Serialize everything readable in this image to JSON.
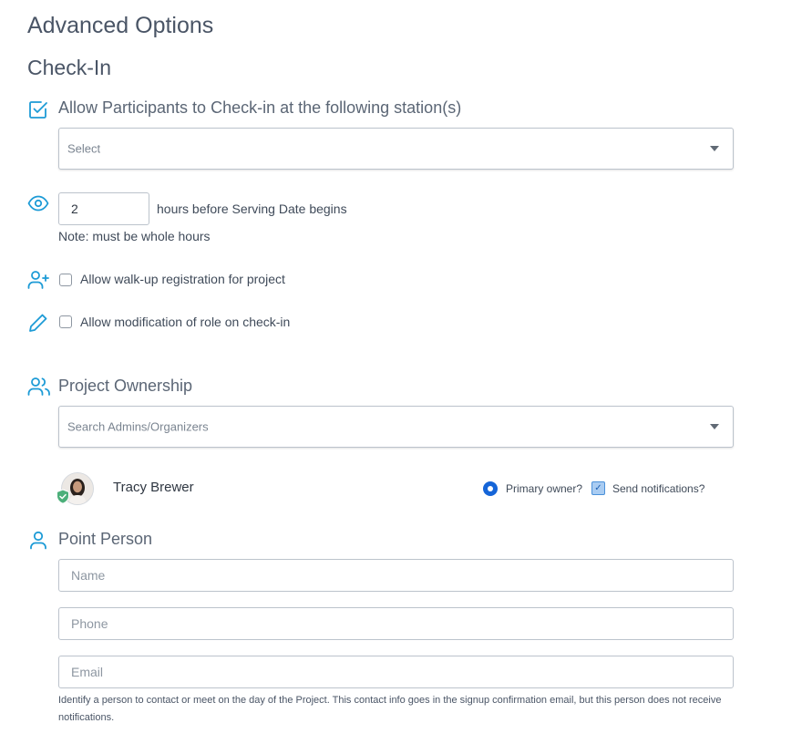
{
  "page": {
    "title": "Advanced Options"
  },
  "checkin": {
    "heading": "Check-In",
    "allow_stations_label": "Allow Participants to Check-in at the following station(s)",
    "station_select_placeholder": "Select",
    "hours_value": "2",
    "hours_label": "hours before Serving Date begins",
    "hours_note": "Note: must be whole hours",
    "walkup_label": "Allow walk-up registration for project",
    "modify_role_label": "Allow modification of role on check-in"
  },
  "ownership": {
    "heading": "Project Ownership",
    "search_placeholder": "Search Admins/Organizers",
    "owners": [
      {
        "name": "Tracy Brewer",
        "primary_label": "Primary owner?",
        "primary_checked": true,
        "notify_label": "Send notifications?",
        "notify_checked": true
      }
    ]
  },
  "point_person": {
    "heading": "Point Person",
    "name_placeholder": "Name",
    "phone_placeholder": "Phone",
    "email_placeholder": "Email",
    "help_text": "Identify a person to contact or meet on the day of the Project. This contact info goes in the signup confirmation email, but this person does not receive notifications."
  },
  "colors": {
    "accent": "#1d9bd6",
    "radio": "#1565d8",
    "text": "#3f4a59",
    "badge": "#4caf7a"
  },
  "icons": {
    "allow_stations": "checkbox-checked-icon",
    "hours": "eye-icon",
    "walkup": "user-plus-icon",
    "modify_role": "pencil-icon",
    "ownership": "users-icon",
    "point_person": "user-icon",
    "owner_badge": "shield-check-icon"
  }
}
